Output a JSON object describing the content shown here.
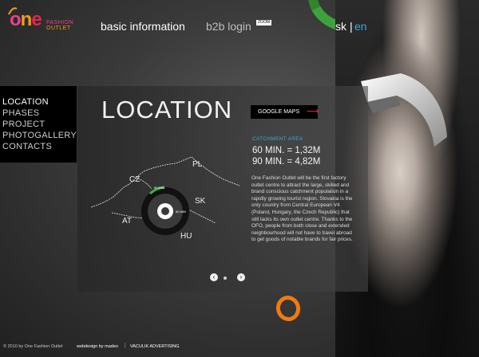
{
  "logo": {
    "word_o": "o",
    "word_n": "n",
    "word_e": "e",
    "subtitle_line1": "FASHION",
    "subtitle_line2": "OUTLET"
  },
  "header": {
    "basic_info": "basic information",
    "b2b_login": "b2b login",
    "b2b_badge": "ZOOM",
    "lang_sk": "sk",
    "lang_separator": "|",
    "lang_en": "en"
  },
  "menu": {
    "items": [
      {
        "label": "LOCATION",
        "active": true
      },
      {
        "label": "PHASES",
        "active": false
      },
      {
        "label": "PROJECT",
        "active": false
      },
      {
        "label": "PHOTOGALLERY",
        "active": false
      },
      {
        "label": "CONTACTS",
        "active": false
      }
    ]
  },
  "panel": {
    "title": "LOCATION",
    "google_maps": "GOOGLE MAPS",
    "catchment_label": "CATCHMENT AREA",
    "catchment_60": "60 MIN. = 1,32M",
    "catchment_90": "90 MIN. = 4,82M",
    "description": "One Fashion Outlet will be the first factory outlet centre to attract the large, skilled and brand conscious catchment population in a rapidly growing tourist region. Slovakia is the only country from Central European V4 (Poland, Hungary, the Czech Republic) that still lacks its own outlet centre. Thanks to the OFO, people from both close and extended neighbourhood will not have to travel abroad to get goods of notable brands for fair prices.",
    "map": {
      "countries": [
        "PL",
        "CZ",
        "SK",
        "AT",
        "HU"
      ],
      "ring_inner_label": "60 MIN",
      "ring_outer_label": "90 MIN"
    },
    "pager": {
      "prev": "‹",
      "next": "›"
    }
  },
  "footer": {
    "copyright": "© 2010 by One Fashion Outlet",
    "webdesign": "webdesign by madeo",
    "separator": "|",
    "agency": "VACULIK ADVERTISING"
  },
  "colors": {
    "accent_blue": "#3ea6d8",
    "brand_pink": "#e8418e",
    "brand_orange": "#f59a1a",
    "brand_red": "#e6264f",
    "ring_green": "#3fae3a"
  },
  "icons": {
    "google_maps_arrow": "arrow-right-icon",
    "pager_prev": "chevron-left-icon",
    "pager_next": "chevron-right-icon"
  }
}
